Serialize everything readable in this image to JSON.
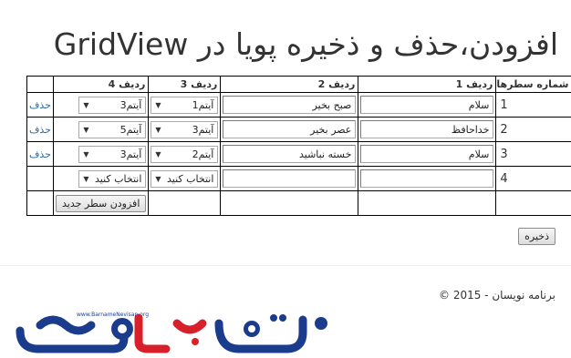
{
  "title": "افزودن،حذف و ذخیره پویا در GridView",
  "grid": {
    "headers": [
      "شماره سطرها",
      "ردیف 1",
      "ردیف 2",
      "ردیف 3",
      "ردیف 4",
      ""
    ],
    "rows": [
      {
        "num": "1",
        "col1": "سلام",
        "col2": "صبح بخیر",
        "col3": "آیتم1",
        "col4": "آیتم3",
        "delete": "حذف"
      },
      {
        "num": "2",
        "col1": "خداحافظ",
        "col2": "عصر بخیر",
        "col3": "آیتم3",
        "col4": "آیتم5",
        "delete": "حذف"
      },
      {
        "num": "3",
        "col1": "سلام",
        "col2": "خسته نباشید",
        "col3": "آیتم2",
        "col4": "آیتم3",
        "delete": "حذف"
      },
      {
        "num": "4",
        "col1": "",
        "col2": "",
        "col3": "انتخاب کنید",
        "col4": "انتخاب کنید",
        "delete": ""
      }
    ],
    "add_row_label": "افزودن سطر جدید"
  },
  "save_label": "ذخیره",
  "footer": "© 2015 - برنامه نویسان",
  "logo": {
    "url_text": "www.BarnameNevisan.org",
    "brand_text": "برنامه نویسان",
    "colors": {
      "primary": "#1b3c8c",
      "accent": "#d8202a"
    }
  }
}
